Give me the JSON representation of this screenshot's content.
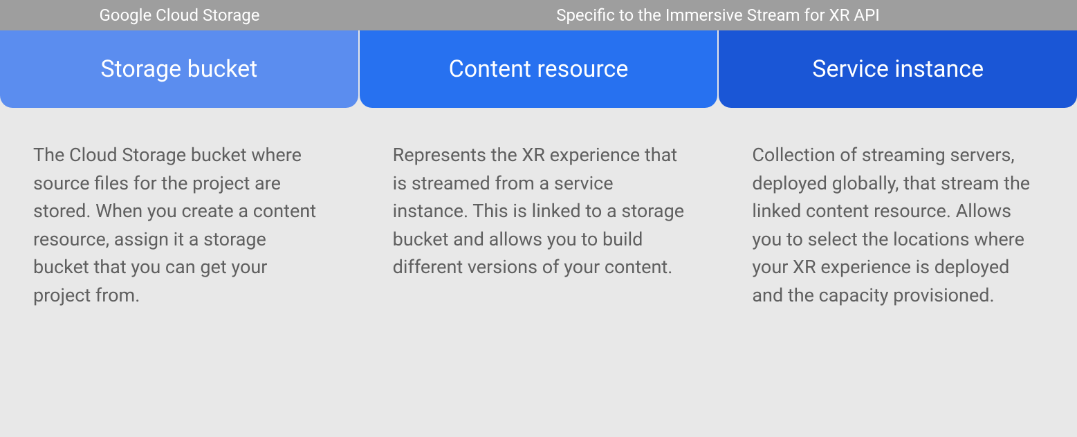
{
  "header": {
    "left": "Google Cloud Storage",
    "right": "Specific to the Immersive Stream for XR API"
  },
  "cards": [
    {
      "title": "Storage bucket",
      "description": "The Cloud Storage bucket where source files for the project are stored. When you create a content resource, assign it a storage bucket that you can get your project from."
    },
    {
      "title": "Content resource",
      "description": "Represents the XR experience that is streamed from a service instance. This is linked to a storage bucket and allows you to build different versions of your content."
    },
    {
      "title": "Service instance",
      "description": "Collection of streaming servers, deployed globally, that stream the linked content resource. Allows you to select the locations where your XR experience is deployed and the capacity provisioned."
    }
  ]
}
